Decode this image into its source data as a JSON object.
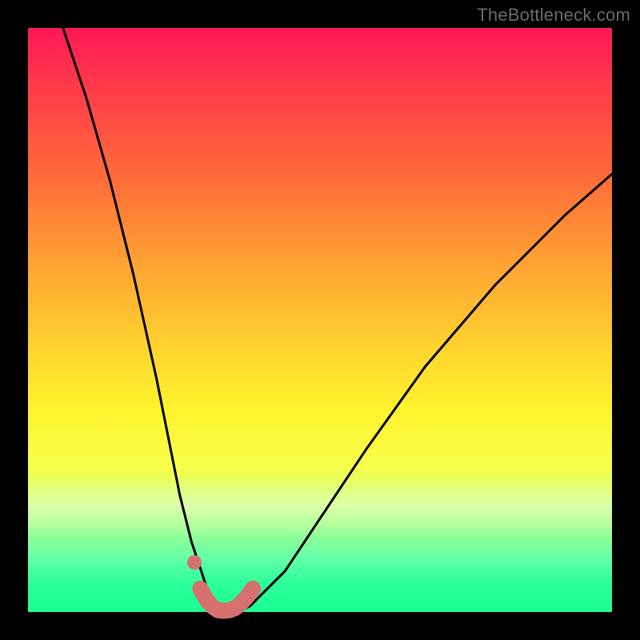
{
  "watermark": "TheBottleneck.com",
  "colors": {
    "frame": "#000000",
    "curve_stroke": "#000000",
    "marker_stroke": "#d6706f",
    "marker_fill": "#d6706f",
    "gradient_top": "#ff1856",
    "gradient_bottom": "#1aff92"
  },
  "chart_data": {
    "type": "line",
    "title": "",
    "xlabel": "",
    "ylabel": "",
    "xlim": [
      0,
      100
    ],
    "ylim": [
      0,
      100
    ],
    "series": [
      {
        "name": "bottleneck-curve",
        "x": [
          6,
          10,
          14,
          18,
          22,
          24,
          26,
          28,
          30,
          31,
          32,
          33,
          34,
          36,
          38,
          40,
          44,
          50,
          58,
          68,
          80,
          92,
          100
        ],
        "y": [
          100,
          88,
          74,
          58,
          40,
          30,
          20,
          12,
          6,
          3,
          1,
          0,
          0,
          0,
          1,
          3,
          7,
          16,
          28,
          42,
          56,
          68,
          75
        ]
      }
    ],
    "markers": {
      "name": "highlighted-range",
      "x": [
        29.5,
        30.5,
        31.5,
        32.5,
        33.5,
        34.5,
        35.5,
        36.5,
        37.5,
        38.5
      ],
      "y": [
        4.0,
        2.2,
        1.0,
        0.3,
        0.2,
        0.3,
        0.7,
        1.5,
        2.6,
        4.0
      ]
    },
    "isolated_marker": {
      "x": 28.5,
      "y": 8.5
    }
  }
}
